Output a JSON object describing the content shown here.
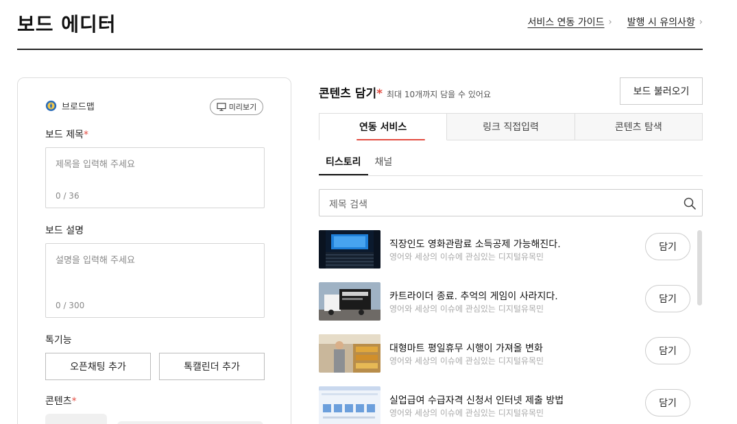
{
  "page": {
    "title": "보드 에디터"
  },
  "top_links": [
    {
      "label": "서비스 연동 가이드"
    },
    {
      "label": "발행 시 유의사항"
    }
  ],
  "editor": {
    "brand_name": "브로드맵",
    "preview_label": "미리보기",
    "board_title": {
      "label": "보드 제목",
      "required_mark": "*",
      "placeholder": "제목을 입력해 주세요",
      "counter": "0 / 36"
    },
    "board_desc": {
      "label": "보드 설명",
      "placeholder": "설명을 입력해 주세요",
      "counter": "0 / 300"
    },
    "talk_features": {
      "label": "톡기능",
      "buttons": [
        "오픈채팅 추가",
        "톡캘린더 추가"
      ]
    },
    "contents": {
      "label": "콘텐츠",
      "required_mark": "*"
    }
  },
  "content_panel": {
    "title": "콘텐츠 담기",
    "required_mark": "*",
    "hint": "최대 10개까지 담을 수 있어요",
    "load_button": "보드 불러오기",
    "tabs": [
      "연동 서비스",
      "링크 직접입력",
      "콘텐츠 탐색"
    ],
    "active_tab": 0,
    "sub_tabs": [
      "티스토리",
      "채널"
    ],
    "active_sub_tab": 0,
    "search_placeholder": "제목 검색",
    "add_label": "담기",
    "items": [
      {
        "title": "직장인도 영화관람료 소득공제 가능해진다.",
        "source": "영어와 세상의 이슈에 관심있는 디지털유목민",
        "thumb": "cinema"
      },
      {
        "title": "카트라이더 종료. 추억의 게임이 사라지다.",
        "source": "영어와 세상의 이슈에 관심있는 디지털유목민",
        "thumb": "truck"
      },
      {
        "title": "대형마트 평일휴무 시행이 가져올 변화",
        "source": "영어와 세상의 이슈에 관심있는 디지털유목민",
        "thumb": "mart"
      },
      {
        "title": "실업급여 수급자격 신청서 인터넷 제출 방법",
        "source": "영어와 세상의 이슈에 관심있는 디지털유목민",
        "thumb": "screen"
      }
    ]
  }
}
